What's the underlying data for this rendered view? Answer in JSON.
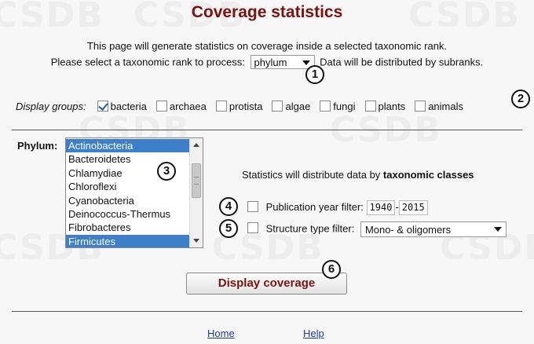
{
  "title": "Coverage statistics",
  "intro": {
    "line1": "This page will generate statistics on coverage inside a selected taxonomic rank.",
    "line2_prefix": "Please select a taxonomic rank to process:",
    "rank_selected": "phylum",
    "line2_suffix": "Data will be distributed by subranks."
  },
  "groups": {
    "label": "Display groups:",
    "items": [
      {
        "label": "bacteria",
        "checked": true
      },
      {
        "label": "archaea",
        "checked": false
      },
      {
        "label": "protista",
        "checked": false
      },
      {
        "label": "algae",
        "checked": false
      },
      {
        "label": "fungi",
        "checked": false
      },
      {
        "label": "plants",
        "checked": false
      },
      {
        "label": "animals",
        "checked": false
      }
    ]
  },
  "phylum": {
    "label": "Phylum:",
    "items": [
      {
        "label": "Actinobacteria",
        "selected": true
      },
      {
        "label": "Bacteroidetes",
        "selected": false
      },
      {
        "label": "Chlamydiae",
        "selected": false
      },
      {
        "label": "Chloroflexi",
        "selected": false
      },
      {
        "label": "Cyanobacteria",
        "selected": false
      },
      {
        "label": "Deinococcus-Thermus",
        "selected": false
      },
      {
        "label": "Fibrobacteres",
        "selected": false
      },
      {
        "label": "Firmicutes",
        "selected": true
      }
    ]
  },
  "distribution": {
    "prefix": "Statistics will distribute data by",
    "emphasis": "taxonomic classes"
  },
  "filters": {
    "pub_year_label": "Publication year filter:",
    "year_from": "1940",
    "year_sep": "-",
    "year_to": "2015",
    "structure_label": "Structure type filter:",
    "structure_selected": "Mono- & oligomers"
  },
  "display_button": "Display coverage",
  "badges": [
    "1",
    "2",
    "3",
    "4",
    "5",
    "6"
  ],
  "watermark": "CSDB",
  "footer": {
    "home": "Home",
    "help": "Help"
  },
  "colors": {
    "title": "#7a1212",
    "selection": "#3d7fc9",
    "link": "#1c3f9e"
  }
}
